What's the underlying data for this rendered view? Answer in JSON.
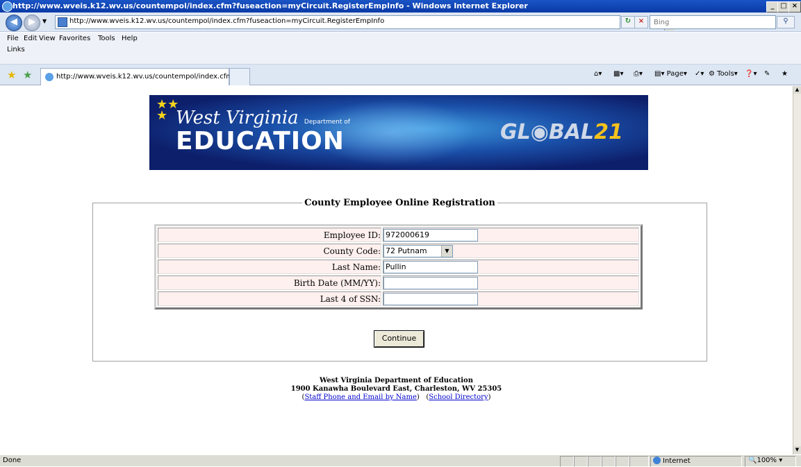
{
  "window": {
    "title": "http://www.wveis.k12.wv.us/countempol/index.cfm?fuseaction=myCircuit.RegisterEmpInfo - Windows Internet Explorer",
    "minimize": "_",
    "maximize": "□",
    "close": "×"
  },
  "address_bar": {
    "url": "http://www.wveis.k12.wv.us/countempol/index.cfm?fuseaction=myCircuit.RegisterEmpInfo",
    "search_placeholder": "Bing"
  },
  "menu": [
    "File",
    "Edit",
    "View",
    "Favorites",
    "Tools",
    "Help"
  ],
  "links_label": "Links",
  "tab": {
    "label": "http://www.wveis.k12.wv.us/countempol/index.cfm?..."
  },
  "toolbar": {
    "page": "Page",
    "tools": "Tools"
  },
  "banner": {
    "line1": "West Virginia",
    "dept": "Department of",
    "line2": "EDUCATION",
    "global_a": "GL◉BAL",
    "global_b": "21"
  },
  "form": {
    "legend": "County Employee Online Registration",
    "fields": [
      {
        "label": "Employee ID:",
        "value": ""
      },
      {
        "label": "County Code:",
        "value": "72 Putnam"
      },
      {
        "label": "Last Name:",
        "value": "Pullin"
      },
      {
        "label": "Birth Date (MM/YY):",
        "value": ""
      },
      {
        "label": "Last 4 of SSN:",
        "value": ""
      }
    ],
    "employee_id": "972000619",
    "continue_label": "Continue"
  },
  "footer": {
    "org": "West Virginia Department of Education",
    "address": "1900 Kanawha Boulevard East, Charleston, WV 25305",
    "link1": "Staff Phone and Email by Name",
    "link2": "School Directory"
  },
  "status": {
    "text": "Done",
    "zone": "Internet",
    "zoom": "100%"
  }
}
